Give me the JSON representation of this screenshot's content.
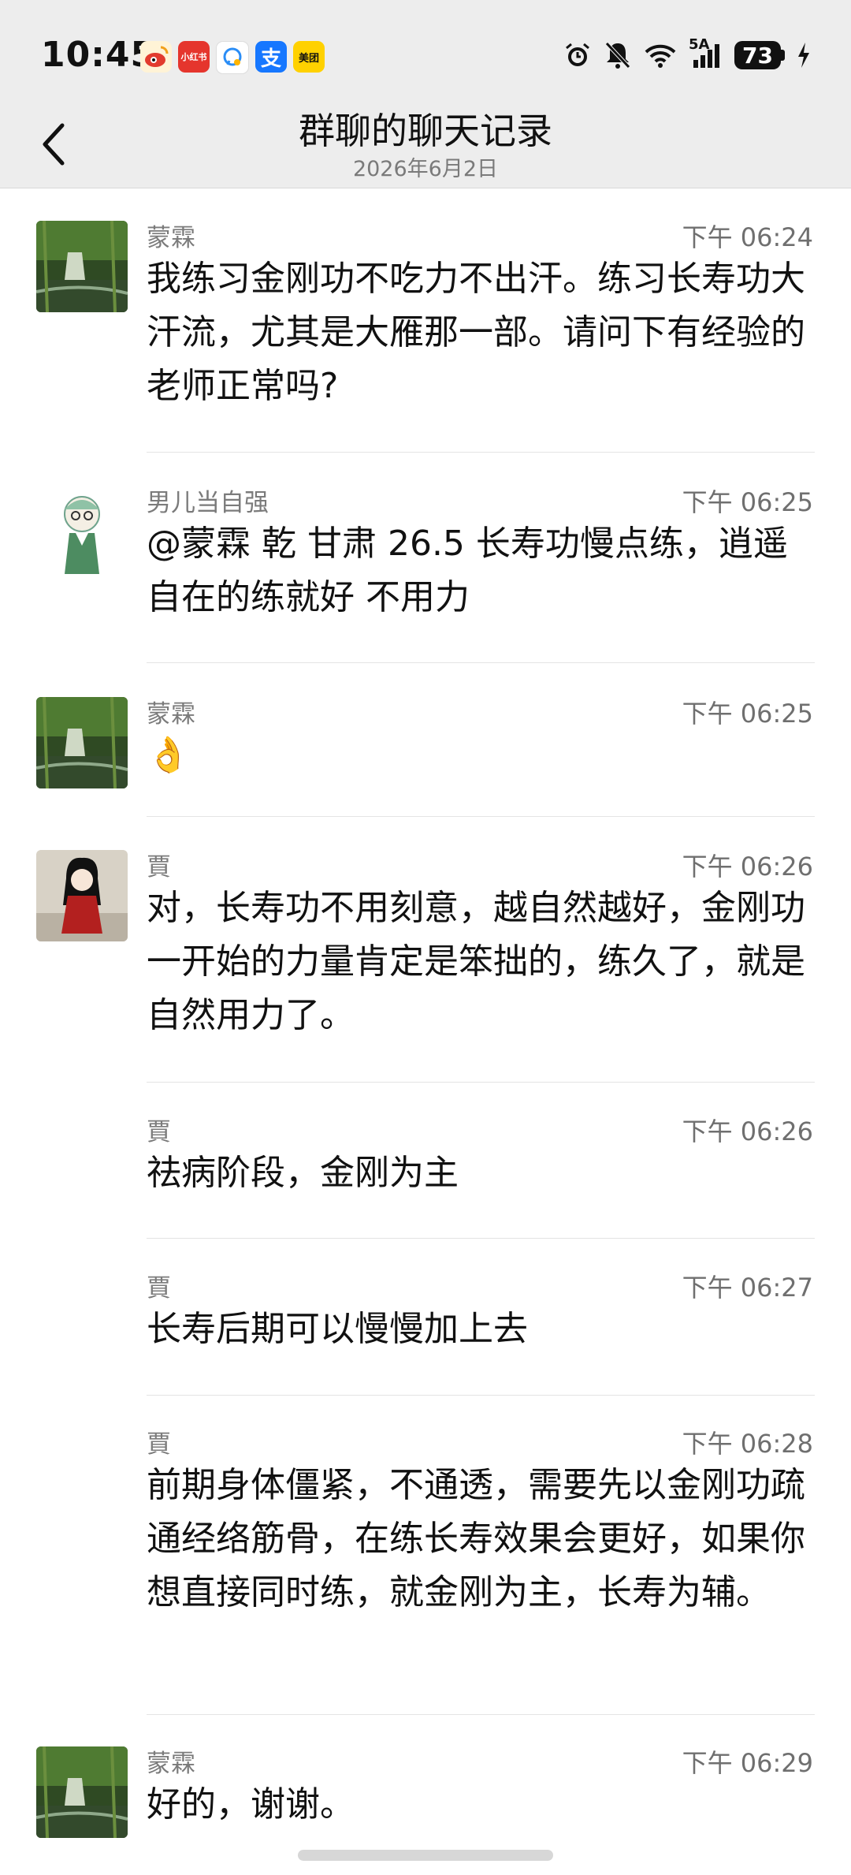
{
  "status_bar": {
    "time": "10:45",
    "app_icons": [
      {
        "name": "weibo-icon",
        "color": "#f2b02a"
      },
      {
        "name": "xiaohongshu-icon",
        "label": "小红书",
        "color": "#e5352d"
      },
      {
        "name": "chat-bubble-icon",
        "color": "#ffffff"
      },
      {
        "name": "alipay-icon",
        "label": "支",
        "color": "#1677ff"
      },
      {
        "name": "meituan-icon",
        "label": "美团",
        "color": "#ffd100"
      }
    ],
    "network_label": "5A",
    "battery": "73"
  },
  "header": {
    "title": "群聊的聊天记录",
    "date": "2026年6月2日"
  },
  "messages": [
    {
      "sender": "蒙霖",
      "time": "下午 06:24",
      "text": "我练习金刚功不吃力不出汗。练习长寿功大汗流，尤其是大雁那一部。请问下有经验的老师正常吗?"
    },
    {
      "sender": "男儿当自强",
      "time": "下午 06:25",
      "text": "@蒙霖  乾 甘肃 26.5 长寿功慢点练，逍遥自在的练就好 不用力"
    },
    {
      "sender": "蒙霖",
      "time": "下午 06:25",
      "text": "👌"
    },
    {
      "sender": "賈",
      "time": "下午 06:26",
      "text": "对，长寿功不用刻意，越自然越好，金刚功一开始的力量肯定是笨拙的，练久了，就是自然用力了。"
    },
    {
      "sender": "賈",
      "time": "下午 06:26",
      "text": "祛病阶段，金刚为主"
    },
    {
      "sender": "賈",
      "time": "下午 06:27",
      "text": "长寿后期可以慢慢加上去"
    },
    {
      "sender": "賈",
      "time": "下午 06:28",
      "text": "前期身体僵紧，不通透，需要先以金刚功疏通经络筋骨，在练长寿效果会更好，如果你想直接同时练，就金刚为主，长寿为辅。"
    },
    {
      "sender": "蒙霖",
      "time": "下午 06:29",
      "text": "好的，谢谢。"
    }
  ]
}
